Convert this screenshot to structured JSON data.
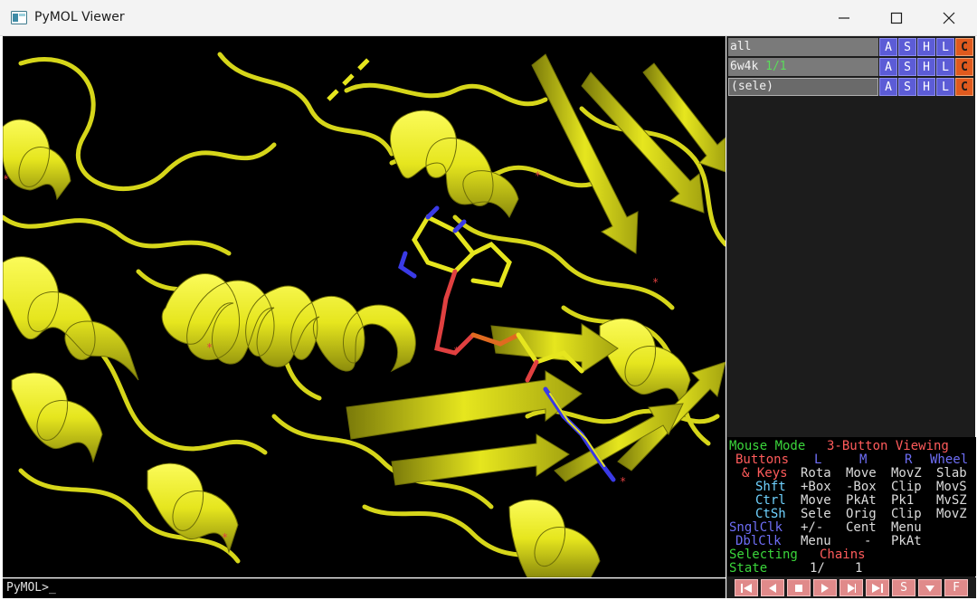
{
  "window": {
    "title": "PyMOL Viewer",
    "icon": "pymol-app-icon",
    "controls": [
      "minimize-icon",
      "maximize-icon",
      "close-icon"
    ]
  },
  "command": {
    "prompt": "PyMOL>_"
  },
  "objects": [
    {
      "name": "all",
      "state": "",
      "buttons": [
        "A",
        "S",
        "H",
        "L",
        "C"
      ]
    },
    {
      "name": "6w4k",
      "state": "1/1",
      "buttons": [
        "A",
        "S",
        "H",
        "L",
        "C"
      ]
    },
    {
      "name": "(sele)",
      "state": "",
      "buttons": [
        "A",
        "S",
        "H",
        "L",
        "C"
      ]
    }
  ],
  "mouse": {
    "mode_label": "Mouse Mode",
    "mode_value": "3-Button Viewing",
    "buttons_label": "Buttons",
    "cols": [
      "L",
      "M",
      "R",
      "Wheel"
    ],
    "keys_label": "& Keys",
    "rows": [
      {
        "key": "",
        "vals": [
          "Rota",
          "Move",
          "MovZ",
          "Slab"
        ]
      },
      {
        "key": "Shft",
        "vals": [
          "+Box",
          "-Box",
          "Clip",
          "MovS"
        ]
      },
      {
        "key": "Ctrl",
        "vals": [
          "Move",
          "PkAt",
          "Pk1",
          "MvSZ"
        ]
      },
      {
        "key": "CtSh",
        "vals": [
          "Sele",
          "Orig",
          "Clip",
          "MovZ"
        ]
      }
    ],
    "click_rows": [
      {
        "key": "SnglClk",
        "vals": [
          "+/-",
          "Cent",
          "Menu"
        ]
      },
      {
        "key": "DblClk",
        "vals": [
          "Menu",
          "-",
          "PkAt"
        ]
      }
    ],
    "selecting_label": "Selecting",
    "selecting_value": "Chains",
    "state_label": "State",
    "state_value": "1/",
    "state_total": "1"
  },
  "vcr": [
    "|<",
    "<",
    "stop",
    ">",
    ">|",
    ">>|",
    "S",
    "v",
    "F"
  ],
  "colors": {
    "ribbon": "#e6e61e",
    "accent_blue": "#5c5cd6",
    "accent_color_btn": "#e05a1e",
    "mode_green": "#3bd63b",
    "mode_red": "#ff5b5b"
  }
}
